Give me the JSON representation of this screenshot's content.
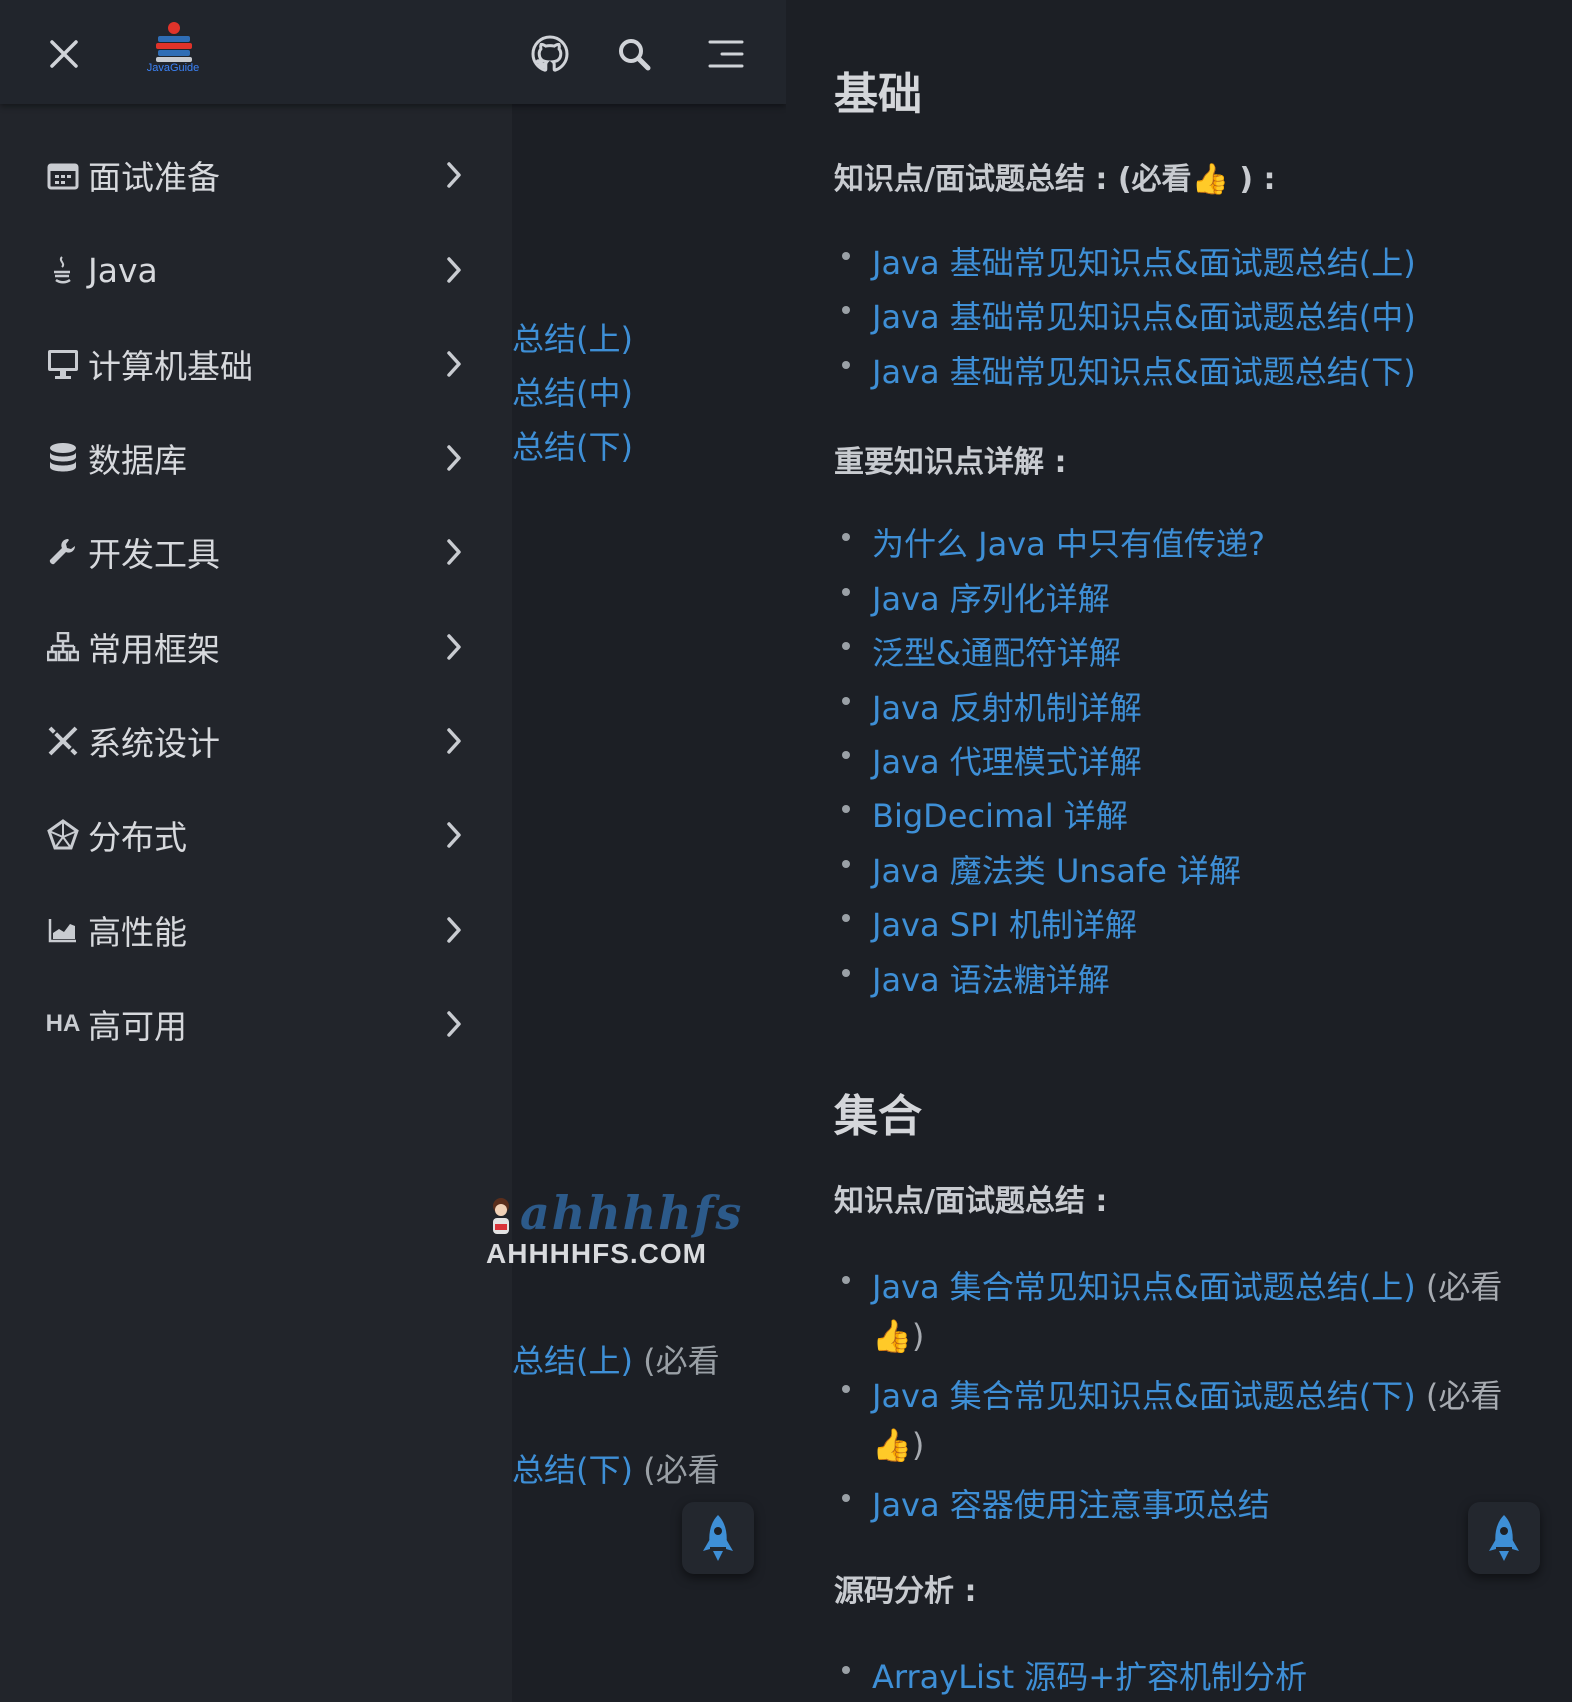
{
  "left": {
    "logo_text": "JavaGuide",
    "nav_items": [
      {
        "label": "面试准备",
        "icon": "calendar-icon"
      },
      {
        "label": "Java",
        "icon": "java-coffee-icon"
      },
      {
        "label": "计算机基础",
        "icon": "computer-monitor-icon"
      },
      {
        "label": "数据库",
        "icon": "database-icon"
      },
      {
        "label": "开发工具",
        "icon": "wrench-icon"
      },
      {
        "label": "常用框架",
        "icon": "sitemap-icon"
      },
      {
        "label": "系统设计",
        "icon": "design-tools-icon"
      },
      {
        "label": "分布式",
        "icon": "distributed-network-icon"
      },
      {
        "label": "高性能",
        "icon": "chart-area-icon"
      },
      {
        "label": "高可用",
        "icon": "ha-text-icon",
        "icon_text": "HA"
      }
    ],
    "behind_links": {
      "l1": "总结(上)",
      "l2": "总结(中)",
      "l3": "总结(下)",
      "l4": "总结(上)",
      "l4_suffix": " (必看",
      "l5": "总结(下)",
      "l5_suffix": " (必看"
    },
    "watermark": {
      "script": "ahhhhfs",
      "domain": "AHHHHFS.COM"
    }
  },
  "right": {
    "section1_title": "基础",
    "section1_p1": "知识点/面试题总结 : (必看👍 ) :",
    "section1_links1": [
      "Java 基础常见知识点&面试题总结(上)",
      "Java 基础常见知识点&面试题总结(中)",
      "Java 基础常见知识点&面试题总结(下)"
    ],
    "section1_p2": "重要知识点详解 :",
    "section1_links2": [
      "为什么 Java 中只有值传递?",
      "Java 序列化详解",
      "泛型&通配符详解",
      "Java 反射机制详解",
      "Java 代理模式详解",
      "BigDecimal 详解",
      "Java 魔法类 Unsafe 详解",
      "Java SPI 机制详解",
      "Java 语法糖详解"
    ],
    "section2_title": "集合",
    "section2_p1": "知识点/面试题总结 :",
    "section2_links": [
      {
        "text": "Java 集合常见知识点&面试题总结(上)",
        "suffix": " (必看",
        "cont": "👍)"
      },
      {
        "text": "Java 集合常见知识点&面试题总结(下)",
        "suffix": " (必看",
        "cont": "👍)"
      },
      {
        "text": "Java 容器使用注意事项总结"
      }
    ],
    "section2_p2": "源码分析 :",
    "section2_links2": [
      "ArrayList 源码+扩容机制分析"
    ]
  },
  "colors": {
    "link": "#3e8fd6",
    "bg": "#1c1f25",
    "sidebar": "#22252b",
    "text": "#d7d9dd"
  }
}
